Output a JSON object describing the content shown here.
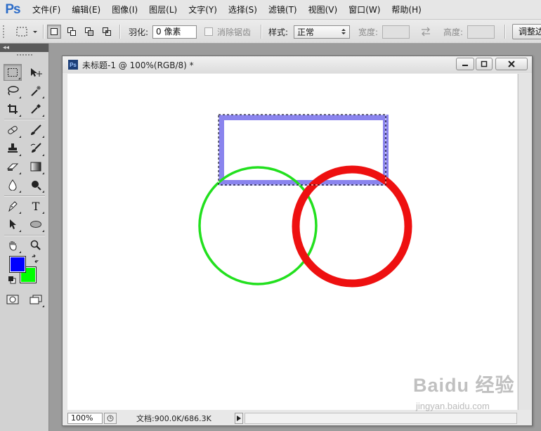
{
  "app": {
    "logo_text": "Ps",
    "menus": [
      "文件(F)",
      "编辑(E)",
      "图像(I)",
      "图层(L)",
      "文字(Y)",
      "选择(S)",
      "滤镜(T)",
      "视图(V)",
      "窗口(W)",
      "帮助(H)"
    ]
  },
  "options": {
    "feather_label": "羽化:",
    "feather_value": "0 像素",
    "antialias_label": "消除锯齿",
    "style_label": "样式:",
    "style_value": "正常",
    "width_label": "宽度:",
    "height_label": "高度:",
    "adjust_edge_label": "调整边缘..."
  },
  "tools": {
    "header_glyph": "◂◂",
    "type_tool_glyph": "T",
    "foreground_color": "#0000ff",
    "background_color": "#00ff00"
  },
  "document": {
    "ps_icon_text": "Ps",
    "title": "未标题-1 @ 100%(RGB/8) *",
    "zoom": "100%",
    "doc_size": "文档:900.0K/686.3K",
    "shapes": {
      "rect_stroke_color": "#8a84ee",
      "green_circle_color": "#22e01e",
      "red_circle_color": "#ee1010"
    }
  },
  "watermark": {
    "brand": "Baidu 经验",
    "url": "jingyan.baidu.com"
  }
}
